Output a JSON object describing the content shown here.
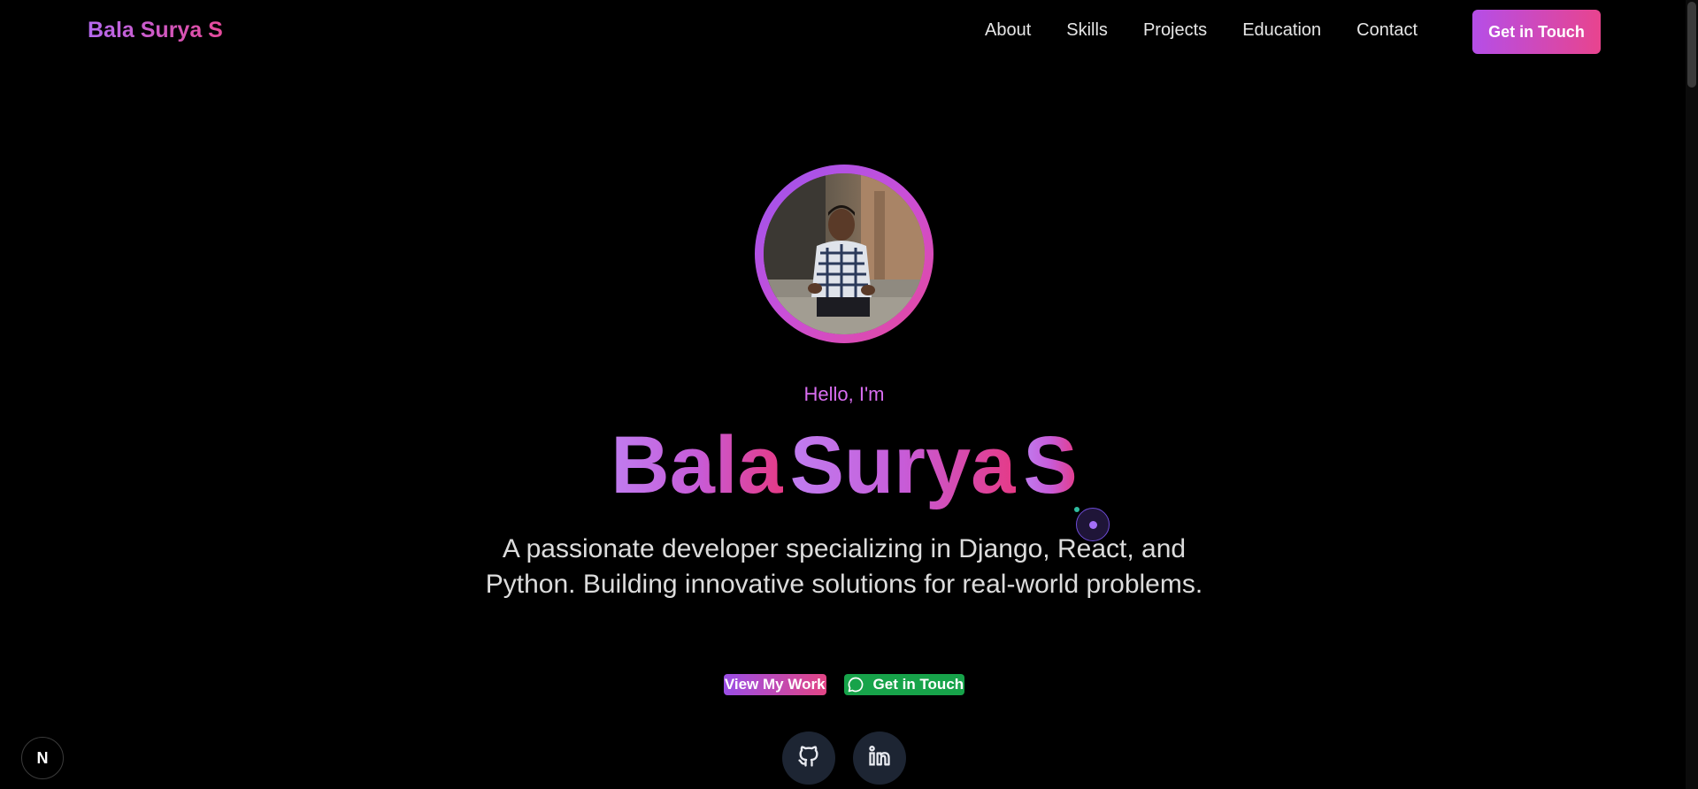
{
  "header": {
    "brand": "Bala Surya S",
    "nav": [
      {
        "label": "About"
      },
      {
        "label": "Skills"
      },
      {
        "label": "Projects"
      },
      {
        "label": "Education"
      },
      {
        "label": "Contact"
      }
    ],
    "cta_label": "Get in Touch"
  },
  "hero": {
    "greeting": "Hello, I'm",
    "name_parts": [
      "Bala",
      "Surya",
      "S"
    ],
    "tagline": "A passionate developer specializing in Django, React, and Python. Building innovative solutions for real-world problems.",
    "primary_button": "View My Work",
    "secondary_button": "Get in Touch"
  },
  "social": [
    {
      "icon": "github-icon"
    },
    {
      "icon": "linkedin-icon"
    }
  ],
  "badge": {
    "label": "N"
  },
  "colors": {
    "background": "#000000",
    "accent_purple": "#b569f0",
    "accent_pink": "#e64a9a",
    "whatsapp_green": "#17a34a",
    "social_bg": "#1d2533"
  }
}
